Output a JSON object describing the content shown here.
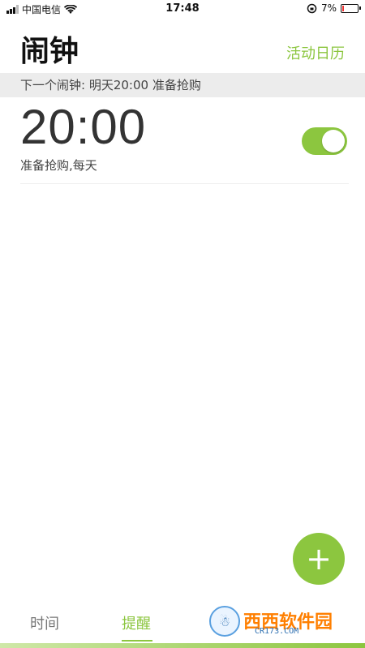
{
  "status_bar": {
    "carrier": "中国电信",
    "time": "17:48",
    "battery_text": "7%",
    "battery_level": 0.07
  },
  "header": {
    "title": "闹钟",
    "calendar_link": "活动日历"
  },
  "next_alarm": {
    "text": "下一个闹钟: 明天20:00  准备抢购"
  },
  "alarms": [
    {
      "time": "20:00",
      "label": "准备抢购,每天",
      "enabled": true
    }
  ],
  "fab": {
    "label": "+"
  },
  "tabs": [
    {
      "label": "时间",
      "active": false
    },
    {
      "label": "提醒",
      "active": true
    }
  ],
  "watermark": {
    "main": "西西软件园",
    "sub": "CR173.COM"
  },
  "colors": {
    "accent": "#8cc63f",
    "bar_bg": "#ececec"
  }
}
